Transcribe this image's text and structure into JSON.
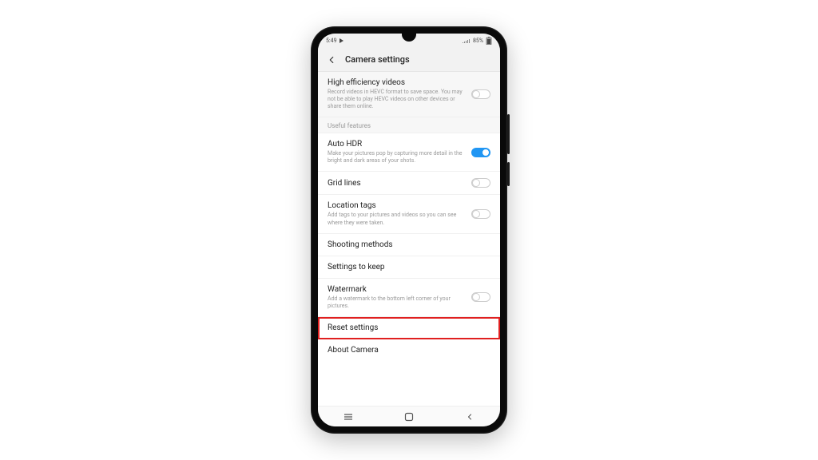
{
  "status": {
    "time": "5:49",
    "battery_pct": "85%"
  },
  "header": {
    "title": "Camera settings"
  },
  "rows": {
    "hev": {
      "title": "High efficiency videos",
      "sub": "Record videos in HEVC format to save space. You may not be able to play HEVC videos on other devices or share them online."
    },
    "section_useful": "Useful features",
    "hdr": {
      "title": "Auto HDR",
      "sub": "Make your pictures pop by capturing more detail in the bright and dark areas of your shots."
    },
    "grid": {
      "title": "Grid lines"
    },
    "loc": {
      "title": "Location tags",
      "sub": "Add tags to your pictures and videos so you can see where they were taken."
    },
    "shoot": {
      "title": "Shooting methods"
    },
    "keep": {
      "title": "Settings to keep"
    },
    "water": {
      "title": "Watermark",
      "sub": "Add a watermark to the bottom left corner of your pictures."
    },
    "reset": {
      "title": "Reset settings"
    },
    "about": {
      "title": "About Camera"
    }
  }
}
